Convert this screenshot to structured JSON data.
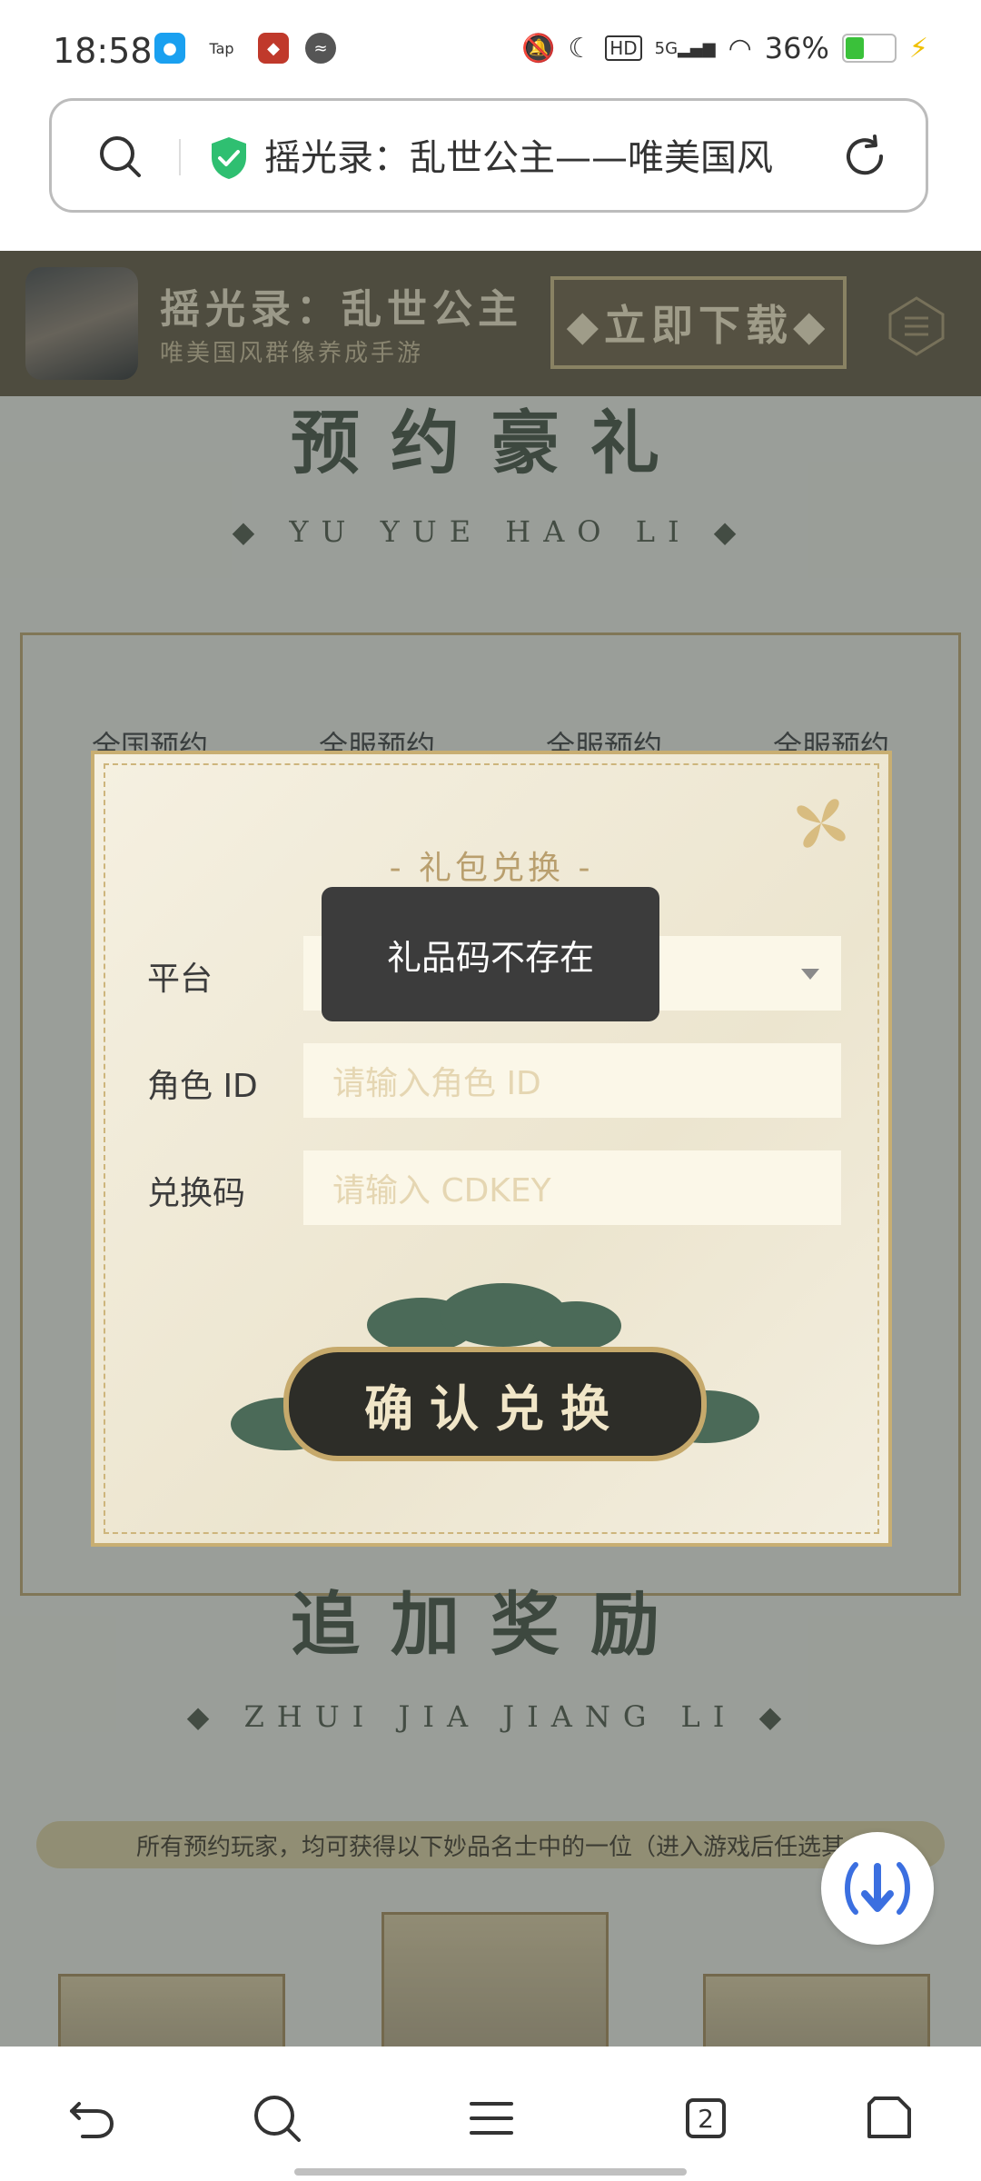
{
  "status_bar": {
    "time": "18:58",
    "app_badge": "Tap",
    "network": "5G",
    "battery_percent": "36%",
    "battery_level": 0.36
  },
  "browser": {
    "url_title": "摇光录：乱世公主——唯美国风"
  },
  "game_banner": {
    "title": "摇光录：乱世公主",
    "subtitle": "唯美国风群像养成手游",
    "download_label": "◆立即下载◆"
  },
  "page": {
    "section1_title": "预约豪礼",
    "section1_en": "◆ YU YUE HAO LI ◆",
    "tabs": [
      "全国预约",
      "全服预约",
      "全服预约",
      "全服预约"
    ],
    "section2_title": "追加奖励",
    "section2_en": "◆ ZHUI JIA JIANG LI ◆",
    "reward_note": "所有预约玩家，均可获得以下妙品名士中的一位（进入游戏后任选其"
  },
  "dialog": {
    "title": "-  礼包兑换  -",
    "platform_label": "平台",
    "role_label": "角色 ID",
    "role_placeholder": "请输入角色 ID",
    "code_label": "兑换码",
    "code_placeholder": "请输入 CDKEY",
    "confirm_label": "确认兑换"
  },
  "toast": {
    "message": "礼品码不存在"
  },
  "nav": {
    "tab_count": "2"
  },
  "colors": {
    "accent_gold": "#c8ae72",
    "banner_brown": "#5e503a",
    "shield_green": "#2fbf71",
    "fab_blue": "#3b6fe0"
  }
}
